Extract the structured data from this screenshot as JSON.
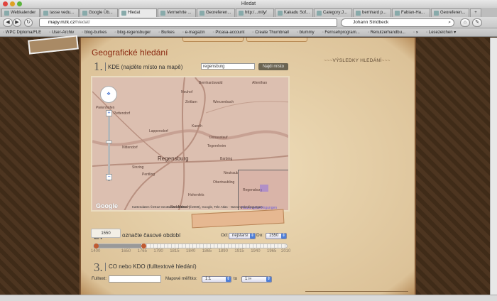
{
  "window": {
    "title": "Hledat"
  },
  "tabs": [
    "Webkalender",
    "tasse vedu...",
    "Google Üb...",
    "Hledat",
    "Vermehrte ...",
    "Georeferen...",
    "http:/...mily/",
    "Kakadu Sof...",
    "Category:J...",
    "bernhard p...",
    "Fabian-Ha...",
    "Georeferen...",
    "+"
  ],
  "toolbar": {
    "url_host": "mapy.mzk.cz",
    "url_path": "/hledat/",
    "search_value": "Johann Stridbeck"
  },
  "bookmarks": [
    "WPC Diploma/FLE",
    "User-Archiv",
    "blog-burkes",
    "blog-regensbuger",
    "Burkes",
    "e-magazin",
    "Picasa-account",
    "Create Thumbnail",
    "blummy",
    "Fernsehprogram...",
    "Renutzerhandbu...",
    "»",
    "Lesezeichen ▾"
  ],
  "page": {
    "heading": "Geografické hledání",
    "step1": {
      "num": "1.",
      "label": "KDE (najděte místo na mapě)",
      "input_value": "regensburg",
      "button": "Najdi místo"
    },
    "results_title": "VÝSLEDKY HLEDÁNÍ",
    "map": {
      "towns": [
        "Bernhardswald",
        "Altenthan",
        "Neuhof",
        "Zeitlarn",
        "Wenzenbach",
        "Pielenhofen",
        "Pettendorf",
        "Lappersdorf",
        "Kareth",
        "Donaustauf",
        "Tegernheim",
        "Nittendorf",
        "Regensburg",
        "Barbing",
        "Sinzing",
        "Pentling",
        "Neutraubling",
        "Obertraubling",
        "Hohenfels",
        "Bad Abbach"
      ],
      "copyright": "Kartendaten ©2012 GeoBasis-DE/BKG (©2009), Google, Tele Atlas - Nutzungsbedingungen",
      "logo": "Google",
      "zoom_in": "+",
      "zoom_out": "−",
      "overview_town": "Regensburg",
      "overview_link": "Nutzungsbedingungen"
    },
    "step2": {
      "num": "2.",
      "label": "označte časové období",
      "od_label": "Od:",
      "od_value": "nejstarší",
      "do_label": "Do:",
      "do_value": "1550",
      "bubble": "1550",
      "slider_min": 1400,
      "slider_max": 2010,
      "range_from": 1400,
      "range_to": 1550,
      "ticks": [
        "1400",
        "1650",
        "1765",
        "1790",
        "1815",
        "1840",
        "1865",
        "1890",
        "1915",
        "1940",
        "1965",
        "2010"
      ]
    },
    "step3": {
      "num": "3.",
      "label": "CO nebo KDO (fulltextové hledání)",
      "fulltext_label": "Fulltext:",
      "fulltext_value": "",
      "scale_label": "Mapové měřítko:",
      "scale_from": "1:1",
      "to_label": "to",
      "scale_to": "1:∞"
    }
  }
}
